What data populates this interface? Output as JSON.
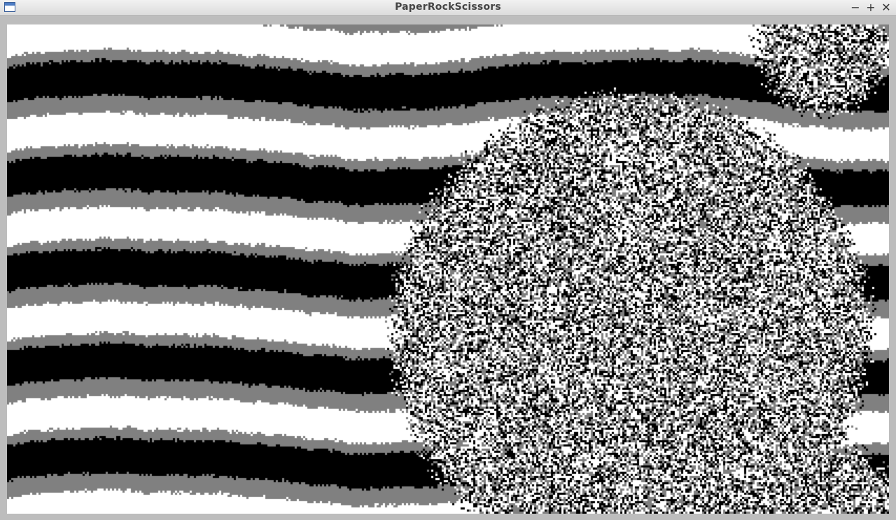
{
  "window": {
    "title": "PaperRockScissors",
    "minimize_symbol": "−",
    "maximize_symbol": "+",
    "close_symbol": "✕",
    "app_icon": "window-icon"
  },
  "simulation": {
    "description_colors": {
      "paper": "#ffffff",
      "rock": "#000000",
      "scissors": "#808080"
    }
  }
}
